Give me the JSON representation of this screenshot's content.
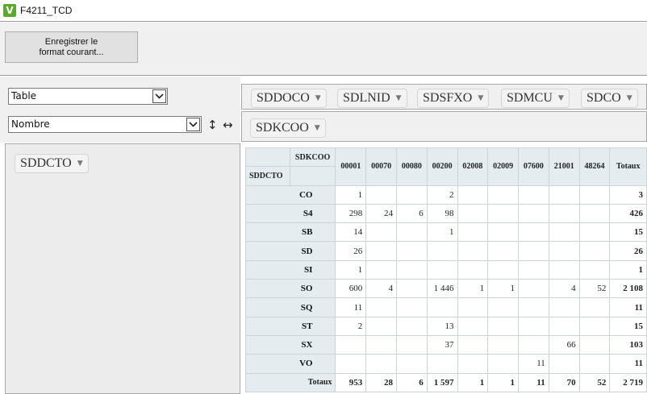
{
  "window": {
    "title": "F4211_TCD",
    "logo": "V"
  },
  "toolbar": {
    "save_label": "Enregistrer le\nformat courant..."
  },
  "controls": {
    "renderer": "Table",
    "aggregator": "Nombre",
    "sort_rows_icon": "↕",
    "sort_cols_icon": "↔"
  },
  "unused_attrs": [
    "SDDOCO",
    "SDLNID",
    "SDSFXO",
    "SDMCU",
    "SDCO"
  ],
  "col_attrs": [
    "SDKCOO"
  ],
  "row_attrs": [
    "SDDCTO"
  ],
  "pivot": {
    "col_attr": "SDKCOO",
    "row_attr": "SDDCTO",
    "columns": [
      "00001",
      "00070",
      "00080",
      "00200",
      "02008",
      "02009",
      "07600",
      "21001",
      "48264"
    ],
    "totals_label": "Totaux",
    "rows": [
      {
        "label": "CO",
        "cells": [
          "1",
          "",
          "",
          "2",
          "",
          "",
          "",
          "",
          ""
        ],
        "total": "3"
      },
      {
        "label": "S4",
        "cells": [
          "298",
          "24",
          "6",
          "98",
          "",
          "",
          "",
          "",
          ""
        ],
        "total": "426"
      },
      {
        "label": "SB",
        "cells": [
          "14",
          "",
          "",
          "1",
          "",
          "",
          "",
          "",
          ""
        ],
        "total": "15"
      },
      {
        "label": "SD",
        "cells": [
          "26",
          "",
          "",
          "",
          "",
          "",
          "",
          "",
          ""
        ],
        "total": "26"
      },
      {
        "label": "SI",
        "cells": [
          "1",
          "",
          "",
          "",
          "",
          "",
          "",
          "",
          ""
        ],
        "total": "1"
      },
      {
        "label": "SO",
        "cells": [
          "600",
          "4",
          "",
          "1 446",
          "1",
          "1",
          "",
          "4",
          "52"
        ],
        "total": "2 108"
      },
      {
        "label": "SQ",
        "cells": [
          "11",
          "",
          "",
          "",
          "",
          "",
          "",
          "",
          ""
        ],
        "total": "11"
      },
      {
        "label": "ST",
        "cells": [
          "2",
          "",
          "",
          "13",
          "",
          "",
          "",
          "",
          ""
        ],
        "total": "15"
      },
      {
        "label": "SX",
        "cells": [
          "",
          "",
          "",
          "37",
          "",
          "",
          "",
          "66",
          ""
        ],
        "total": "103"
      },
      {
        "label": "VO",
        "cells": [
          "",
          "",
          "",
          "",
          "",
          "",
          "11",
          "",
          ""
        ],
        "total": "11"
      }
    ],
    "col_totals": [
      "953",
      "28",
      "6",
      "1 597",
      "1",
      "1",
      "11",
      "70",
      "52"
    ],
    "grand_total": "2 719"
  }
}
